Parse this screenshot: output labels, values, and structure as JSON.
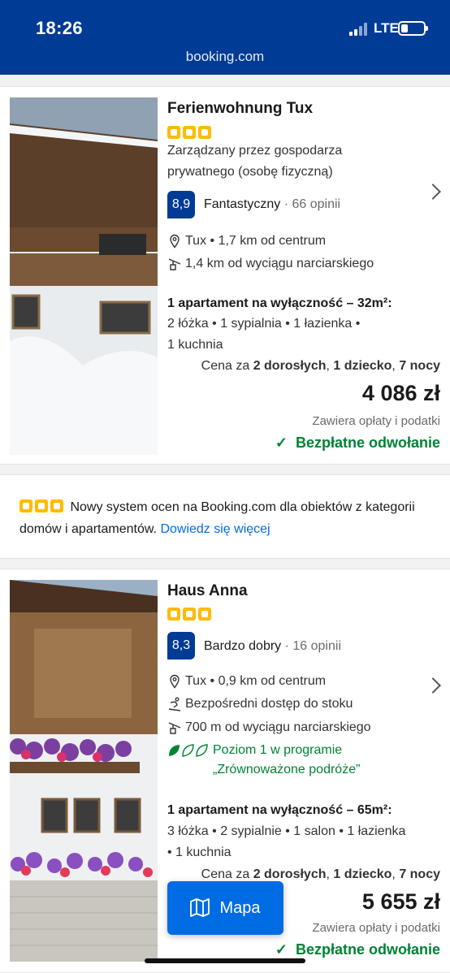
{
  "status_bar": {
    "time": "18:26",
    "network": "LTE",
    "url": "booking.com"
  },
  "listings": [
    {
      "title": "Ferienwohnung Tux",
      "stars": 3,
      "host": [
        "Zarządzany przez gospodarza",
        "prywatnego (osobę fizyczną)"
      ],
      "score": "8,9",
      "rating_word": "Fantastyczny",
      "reviews": "66 opinii",
      "location": "Tux • 1,7 km od centrum",
      "ski_lift": "1,4 km od wyciągu narciarskiego",
      "unit_title": "1 apartament na wyłączność – 32m²:",
      "unit_details": [
        "2 łóżka • 1 sypialnia • 1 łazienka •",
        "1 kuchnia"
      ],
      "price_for_prefix": "Cena za ",
      "price_for_bold1": "2 dorosłych",
      "price_for_sep": ", ",
      "price_for_bold2": "1 dziecko",
      "price_for_sep2": ", ",
      "price_for_bold3": "7 nocy",
      "price": "4 086 zł",
      "taxes": "Zawiera opłaty i podatki",
      "cancellation": "Bezpłatne odwołanie"
    },
    {
      "title": "Haus Anna",
      "stars": 3,
      "score": "8,3",
      "rating_word": "Bardzo dobry",
      "reviews": "16 opinii",
      "location": "Tux • 0,9 km od centrum",
      "slope": "Bezpośredni dostęp do stoku",
      "ski_lift": "700 m od wyciągu narciarskiego",
      "sustainability": [
        "Poziom 1 w programie",
        "„Zrównoważone podróże”"
      ],
      "unit_title": "1 apartament na wyłączność – 65m²:",
      "unit_details": [
        "3 łóżka • 2 sypialnie • 1 salon • 1 łazienka",
        "• 1 kuchnia"
      ],
      "price_for_prefix": "Cena za ",
      "price_for_bold1": "2 dorosłych",
      "price_for_sep": ", ",
      "price_for_bold2": "1 dziecko",
      "price_for_sep2": ", ",
      "price_for_bold3": "7 nocy",
      "price": "5 655 zł",
      "taxes": "Zawiera opłaty i podatki",
      "cancellation": "Bezpłatne odwołanie"
    }
  ],
  "notice": {
    "text": "Nowy system ocen na Booking.com dla obiektów z kategorii domów i apartamentów.",
    "link": "Dowiedz się więcej"
  },
  "map_button": "Mapa",
  "colors": {
    "brand": "#003b95",
    "accent": "#006ce4",
    "star": "#febb02",
    "green": "#008234"
  }
}
